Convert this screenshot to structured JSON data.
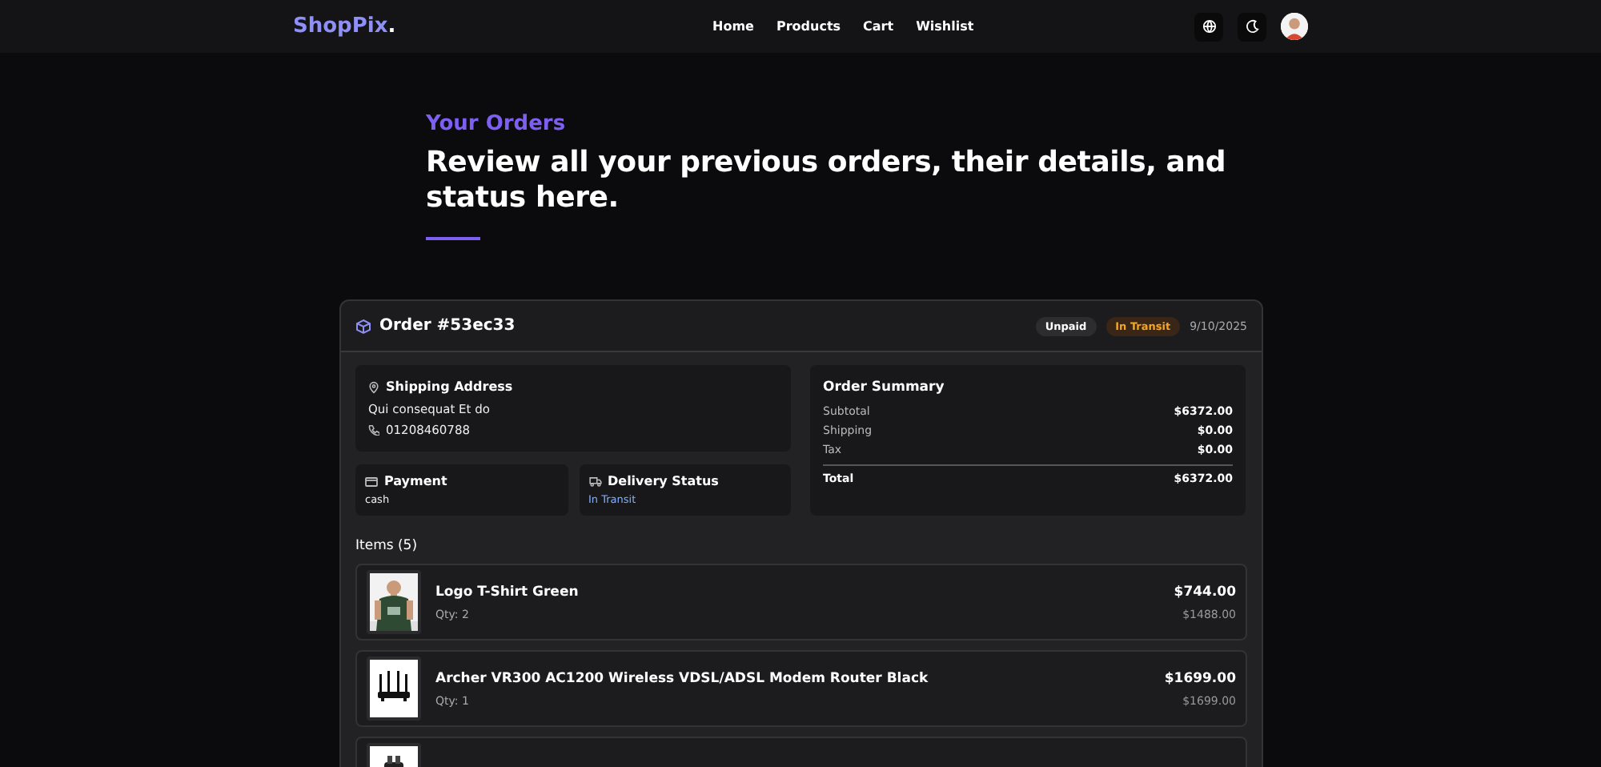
{
  "header": {
    "brand": "ShopPix",
    "brand_mark": ".",
    "nav": [
      {
        "label": "Home"
      },
      {
        "label": "Products"
      },
      {
        "label": "Cart"
      },
      {
        "label": "Wishlist"
      }
    ]
  },
  "intro": {
    "eyebrow": "Your Orders",
    "headline": "Review all your previous orders, their details, and status here."
  },
  "order": {
    "title": "Order #53ec33",
    "badges": [
      {
        "label": "Unpaid",
        "color": "#2d2d30"
      },
      {
        "label": "In Transit",
        "color": "#3a2616"
      }
    ],
    "date": "9/10/2025",
    "shipping": {
      "title": "Shipping Address",
      "name": "Qui consequat Et do",
      "phone": "01208460788"
    },
    "payment": {
      "title": "Payment",
      "value": "cash"
    },
    "delivery": {
      "title": "Delivery Status",
      "value": "In Transit"
    },
    "summary": {
      "title": "Order Summary",
      "rows": [
        {
          "label": "Subtotal",
          "value": "$6372.00"
        },
        {
          "label": "Shipping",
          "value": "$0.00"
        },
        {
          "label": "Tax",
          "value": "$0.00"
        }
      ],
      "total": {
        "label": "Total",
        "value": "$6372.00"
      }
    },
    "items_title": "Items (5)",
    "items": [
      {
        "name": "Logo T-Shirt Green",
        "qty": "Qty: 2",
        "price": "$744.00",
        "line_total": "$1488.00",
        "kind": "picture"
      },
      {
        "name": "Archer VR300 AC1200 Wireless VDSL/ADSL Modem Router Black",
        "qty": "Qty: 1",
        "price": "$1699.00",
        "line_total": "$1699.00",
        "kind": "picture"
      },
      {
        "kind": "picture"
      }
    ]
  }
}
